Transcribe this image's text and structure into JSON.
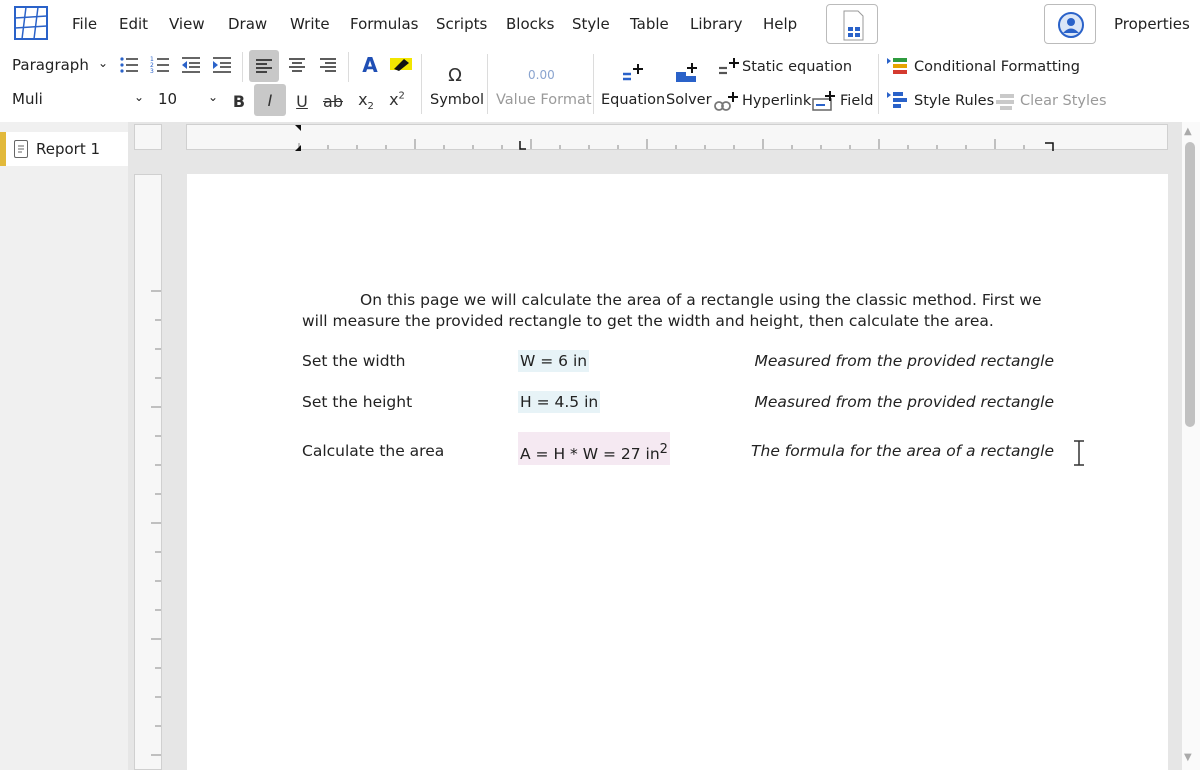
{
  "menu": [
    "File",
    "Edit",
    "View",
    "Draw",
    "Write",
    "Formulas",
    "Scripts",
    "Blocks",
    "Style",
    "Table",
    "Library",
    "Help"
  ],
  "properties_label": "Properties",
  "toolbar": {
    "paragraph_style": "Paragraph",
    "font_family": "Muli",
    "font_size": "10",
    "bold": "B",
    "italic": "I",
    "underline": "U",
    "strike": "ab",
    "symbol": "Symbol",
    "value_format": "Value Format",
    "value_format_preview": "0.00",
    "equation": "Equation",
    "solver": "Solver",
    "static_equation": "Static equation",
    "hyperlink": "Hyperlink",
    "field": "Field",
    "conditional_formatting": "Conditional Formatting",
    "style_rules": "Style Rules",
    "clear_styles": "Clear Styles"
  },
  "documents": [
    {
      "name": "Report 1",
      "active": true
    }
  ],
  "page": {
    "intro": "On this page we will calculate the area of a rectangle using the classic method. First we will measure the provided rectangle to get the width and height, then calculate the area.",
    "rows": [
      {
        "label": "Set the width",
        "equation": "W = 6 in",
        "note": "Measured from the provided rectangle"
      },
      {
        "label": "Set the height",
        "equation": "H = 4.5 in",
        "note": "Measured from the provided rectangle"
      },
      {
        "label": "Calculate the area",
        "equation": "A = H * W = 27 in",
        "equation_sup": "2",
        "note": "The formula for the area of a rectangle"
      }
    ]
  },
  "colors": {
    "accent_blue": "#2a62c9",
    "doc_tab_marker": "#e2b93b",
    "input_highlight": "#e7f3f7",
    "result_highlight": "#f5e9f2"
  }
}
